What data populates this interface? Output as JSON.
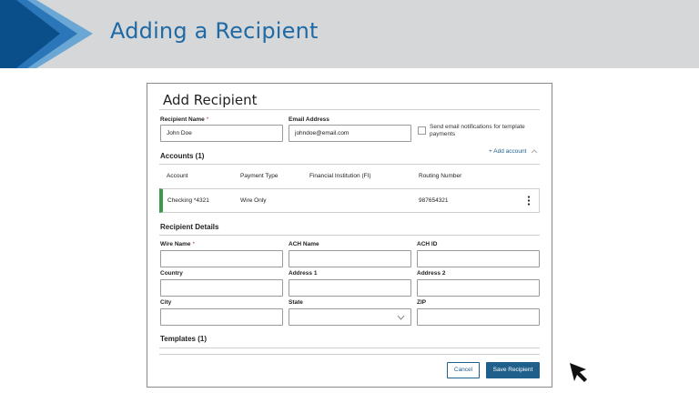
{
  "slide": {
    "title": "Adding a Recipient"
  },
  "dialog": {
    "title": "Add Recipient",
    "recipient_name": {
      "label": "Recipient Name",
      "required": "*",
      "value": "John Doe"
    },
    "email_address": {
      "label": "Email Address",
      "value": "johndoe@email.com"
    },
    "notify_checkbox_label_line1": "Send email notifications for template",
    "notify_checkbox_label_line2": "payments",
    "add_account_label": "+ Add account",
    "accounts_header": "Accounts (1)",
    "accounts_columns": [
      "Account",
      "Payment Type",
      "Financial Institution (FI)",
      "Routing Number"
    ],
    "accounts": [
      {
        "account": "Checking *4321",
        "payment_type": "Wire Only",
        "fi": "",
        "routing": "987654321"
      }
    ],
    "recipient_details_header": "Recipient Details",
    "fields": {
      "wire_name": {
        "label": "Wire Name",
        "required": "*"
      },
      "ach_name": {
        "label": "ACH Name"
      },
      "ach_id": {
        "label": "ACH ID"
      },
      "country": {
        "label": "Country"
      },
      "address1": {
        "label": "Address 1"
      },
      "address2": {
        "label": "Address 2"
      },
      "city": {
        "label": "City"
      },
      "state": {
        "label": "State"
      },
      "zip": {
        "label": "ZIP"
      }
    },
    "templates_header": "Templates (1)",
    "cancel_label": "Cancel",
    "save_label": "Save Recipient"
  },
  "colors": {
    "accent": "#1f6aa5",
    "primary_button": "#1f5f8b",
    "account_stripe": "#3a9a4a",
    "banner_bg": "#d6d7d9"
  },
  "icons": {
    "kebab": "more-vertical-icon",
    "state_dropdown": "chevron-down-icon",
    "accounts_toggle": "chevron-up-icon",
    "cursor": "arrow-cursor-icon",
    "banner": "chevron-logo-icon"
  }
}
